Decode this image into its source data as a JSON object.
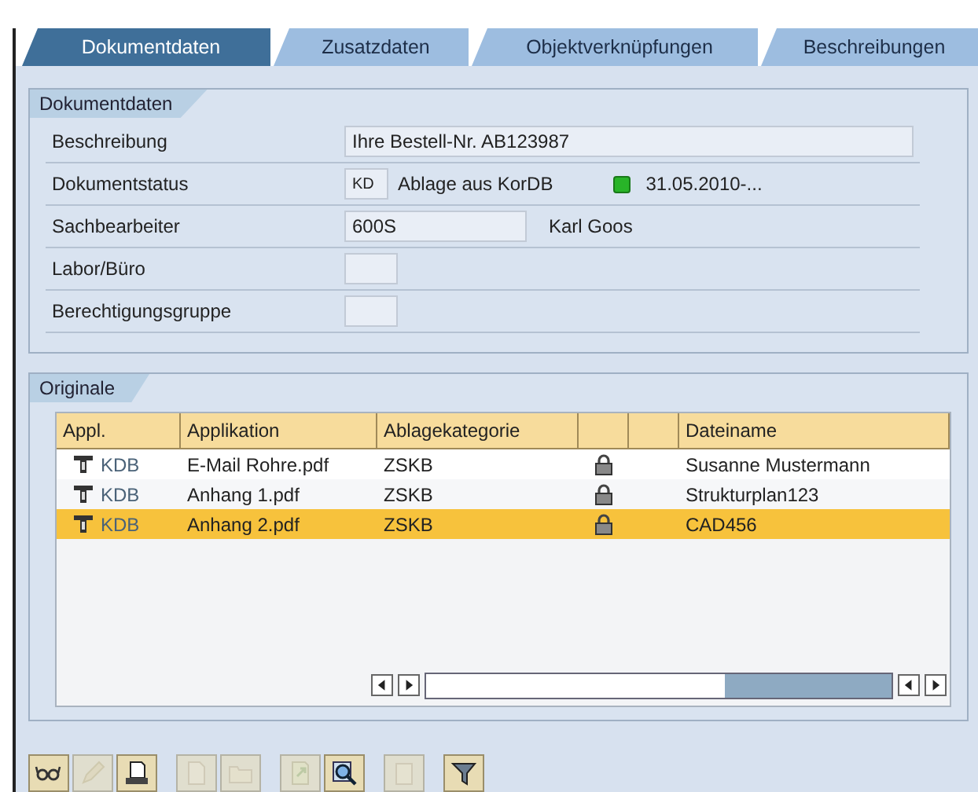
{
  "tabs": [
    {
      "label": "Dokumentdaten",
      "selected": true
    },
    {
      "label": "Zusatzdaten",
      "selected": false
    },
    {
      "label": "Objektverknüpfungen",
      "selected": false
    },
    {
      "label": "Beschreibungen",
      "selected": false
    }
  ],
  "document_group": {
    "title": "Dokumentdaten",
    "fields": [
      {
        "label": "Beschreibung",
        "kind": "wide",
        "value": "Ihre Bestell-Nr. AB123987"
      },
      {
        "label": "Dokumentstatus",
        "kind": "status",
        "value": "KD",
        "text": "Ablage aus KorDB",
        "date": "31.05.2010-..."
      },
      {
        "label": "Sachbearbeiter",
        "kind": "person",
        "value": "600S",
        "text": "Karl Goos"
      },
      {
        "label": "Labor/Büro",
        "kind": "small"
      },
      {
        "label": "Berechtigungsgruppe",
        "kind": "small"
      }
    ]
  },
  "originals_group": {
    "title": "Originale",
    "columns": [
      "Appl.",
      "Applikation",
      "Ablagekategorie",
      "Dateiname"
    ],
    "rows": [
      {
        "appl": "KDB",
        "file": "E-Mail Rohre.pdf",
        "category": "ZSKB",
        "locked": true,
        "name": "Susanne Mustermann",
        "selected": false
      },
      {
        "appl": "KDB",
        "file": "Anhang 1.pdf",
        "category": "ZSKB",
        "locked": true,
        "name": "Strukturplan123",
        "selected": false
      },
      {
        "appl": "KDB",
        "file": "Anhang 2.pdf",
        "category": "ZSKB",
        "locked": true,
        "name": "CAD456",
        "selected": true
      }
    ]
  },
  "toolbar": [
    {
      "kind": "glasses",
      "disabled": false
    },
    {
      "kind": "pencil",
      "disabled": true
    },
    {
      "kind": "print",
      "disabled": false
    },
    {
      "kind": "new",
      "disabled": true
    },
    {
      "kind": "open",
      "disabled": true
    },
    {
      "kind": "export",
      "disabled": true
    },
    {
      "kind": "zoom",
      "disabled": false
    },
    {
      "kind": "delete",
      "disabled": true
    },
    {
      "kind": "filter",
      "disabled": false
    }
  ]
}
